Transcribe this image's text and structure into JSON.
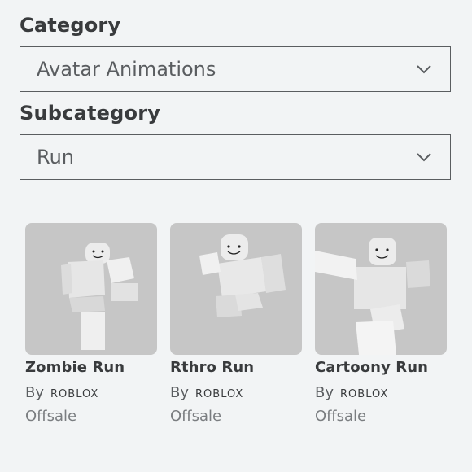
{
  "filters": {
    "category_label": "Category",
    "category_value": "Avatar Animations",
    "subcategory_label": "Subcategory",
    "subcategory_value": "Run"
  },
  "items": [
    {
      "name": "Zombie Run",
      "by": "By",
      "creator": "ROBLOX",
      "price": "Offsale"
    },
    {
      "name": "Rthro Run",
      "by": "By",
      "creator": "ROBLOX",
      "price": "Offsale"
    },
    {
      "name": "Cartoony Run",
      "by": "By",
      "creator": "ROBLOX",
      "price": "Offsale"
    }
  ],
  "icons": {
    "dropdown": "chevron-down-icon"
  },
  "colors": {
    "background": "#f2f4f5",
    "thumbnail": "#c6c6c6",
    "text": "#393b3d"
  }
}
